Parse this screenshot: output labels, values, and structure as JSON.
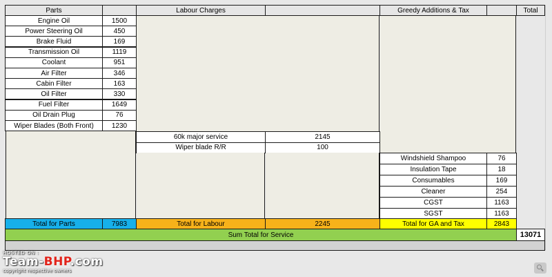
{
  "headers": {
    "parts": "Parts",
    "labour": "Labour Charges",
    "greedy": "Greedy Additions & Tax",
    "total": "Total"
  },
  "parts": [
    {
      "name": "Engine Oil",
      "cost": "1500"
    },
    {
      "name": "Power Steering Oil",
      "cost": "450"
    },
    {
      "name": "Brake Fluid",
      "cost": "169"
    },
    {
      "name": "Transmission Oil",
      "cost": "1119"
    },
    {
      "name": "Coolant",
      "cost": "951"
    },
    {
      "name": "Air Filter",
      "cost": "346"
    },
    {
      "name": "Cabin Filter",
      "cost": "163"
    },
    {
      "name": "Oil Filter",
      "cost": "330"
    },
    {
      "name": "Fuel Filter",
      "cost": "1649"
    },
    {
      "name": "Oil Drain Plug",
      "cost": "76"
    },
    {
      "name": "Wiper Blades (Both Front)",
      "cost": "1230"
    }
  ],
  "labour": [
    {
      "name": "60k major service",
      "cost": "2145"
    },
    {
      "name": "Wiper blade R/R",
      "cost": "100"
    }
  ],
  "greedy": [
    {
      "name": "Windshield Shampoo",
      "cost": "76"
    },
    {
      "name": "Insulation Tape",
      "cost": "18"
    },
    {
      "name": "Consumables",
      "cost": "169"
    },
    {
      "name": "Cleaner",
      "cost": "254"
    },
    {
      "name": "CGST",
      "cost": "1163"
    },
    {
      "name": "SGST",
      "cost": "1163"
    }
  ],
  "totals": {
    "parts_label": "Total for Parts",
    "parts_value": "7983",
    "labour_label": "Total for Labour",
    "labour_value": "2245",
    "ga_label": "Total for GA and Tax",
    "ga_value": "2843",
    "sum_label": "Sum Total for Service",
    "sum_value": "13071"
  },
  "colors": {
    "parts_total": "#16b0ea",
    "labour_total": "#f7b21a",
    "ga_total": "#ffff00",
    "sum_total": "#92d050"
  },
  "watermark": {
    "hosted": "HOSTED ON :",
    "brand_a": "Team-",
    "brand_b": "BHP",
    "brand_c": ".com",
    "copyright": "copyright respective owners"
  },
  "zoom_icon": "magnifier-icon"
}
